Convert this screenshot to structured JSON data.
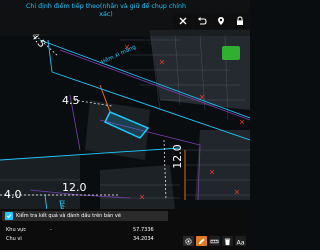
{
  "header": {
    "instruction": "Chỉ định điểm tiếp theo(nhấn và giữ để chụp chính xác)"
  },
  "map": {
    "street_label": "Hẻm xi măng",
    "street_label_bottom": "Hẻm xi",
    "dims": {
      "d1": "4.5",
      "d2": "4.5",
      "d3": "12.0",
      "d4": "4.0",
      "d5": "12.0"
    }
  },
  "status": {
    "text": "Kiểm tra kết quả và đánh dấu trên bản vẽ"
  },
  "info": {
    "area_label": "Khu vực",
    "area_dash": "-",
    "area_value": "57.7336",
    "perimeter_label": "Chu vi",
    "perimeter_value": "34.2034"
  },
  "toolbar": {
    "icons": [
      "close-icon",
      "undo-icon",
      "pin-icon",
      "lock-icon"
    ]
  },
  "colors": {
    "cyan": "#1ec8ff",
    "green": "#2fb02e",
    "purple": "#7b3fb5",
    "orange": "#e57a1c"
  }
}
